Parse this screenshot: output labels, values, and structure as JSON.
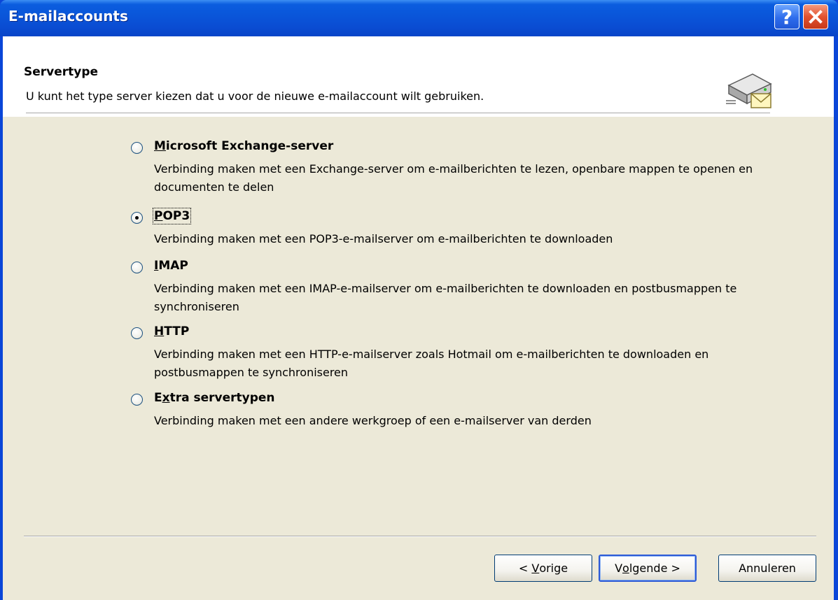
{
  "window": {
    "title": "E-mailaccounts",
    "help_glyph": "?",
    "close_icon": "close-x-icon"
  },
  "header": {
    "title": "Servertype",
    "subtitle": "U kunt het type server kiezen dat u voor de nieuwe e-mailaccount wilt gebruiken.",
    "icon": "server-mail-icon"
  },
  "server_options": [
    {
      "mnemonic": "M",
      "label_rest": "icrosoft Exchange-server",
      "selected": false,
      "description": "Verbinding maken met een Exchange-server om e-mailberichten te lezen, openbare mappen te openen en documenten te delen"
    },
    {
      "mnemonic": "P",
      "label_rest": "OP3",
      "selected": true,
      "description": "Verbinding maken met een POP3-e-mailserver om e-mailberichten te downloaden"
    },
    {
      "mnemonic": "I",
      "label_rest": "MAP",
      "selected": false,
      "description": "Verbinding maken met een IMAP-e-mailserver om e-mailberichten te downloaden en postbusmappen te synchroniseren"
    },
    {
      "mnemonic": "H",
      "label_rest": "TTP",
      "selected": false,
      "description": "Verbinding maken met een HTTP-e-mailserver zoals Hotmail om e-mailberichten te downloaden en postbusmappen te synchroniseren"
    },
    {
      "mnemonic": "x",
      "label_before": "E",
      "label_rest": "tra servertypen",
      "selected": false,
      "description": "Verbinding maken met een andere werkgroep of een e-mailserver van derden"
    }
  ],
  "buttons": {
    "prev_before": "< ",
    "prev_mnemonic": "V",
    "prev_rest": "orige",
    "next_before": "V",
    "next_mnemonic": "o",
    "next_rest": "lgende >",
    "cancel": "Annuleren"
  }
}
